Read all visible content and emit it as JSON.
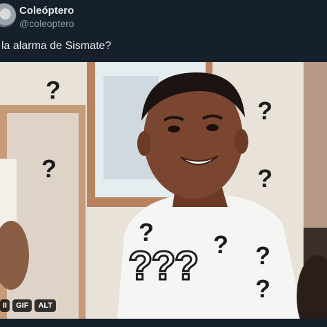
{
  "tweet": {
    "display_name": "Coleóptero",
    "handle": "@coleoptero",
    "text": "la alarma de Sismate?"
  },
  "media": {
    "gif_badge": "GIF",
    "alt_badge": "ALT",
    "play_badge": "II",
    "overlay_marks": [
      "?",
      "?",
      "?",
      "?",
      "?",
      "?",
      "?",
      "?"
    ],
    "big_marks": "???"
  },
  "colors": {
    "background": "#15202b",
    "text_primary": "#e7e9ea",
    "text_secondary": "#8b98a5"
  }
}
